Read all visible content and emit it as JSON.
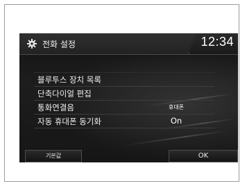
{
  "header": {
    "icon": "gear-icon",
    "title": "전화 설정",
    "clock": "12:34"
  },
  "menu": {
    "items": [
      {
        "label": "블루투스 장치 목록",
        "value": ""
      },
      {
        "label": "단축다이얼 편집",
        "value": ""
      },
      {
        "label": "통화연결음",
        "value": "휴대폰"
      },
      {
        "label": "자동 휴대폰 동기화",
        "value": "On"
      }
    ]
  },
  "footer": {
    "default_label": "기본값",
    "ok_label": "OK"
  },
  "colors": {
    "screen_background": "#1a1a1a",
    "text": "#efefef",
    "divider": "#3d3d3d"
  }
}
